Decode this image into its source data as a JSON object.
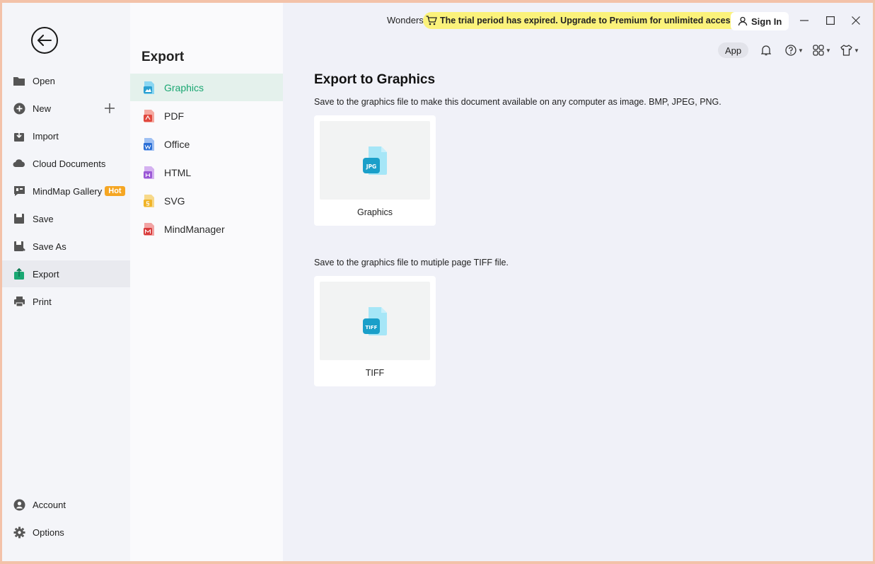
{
  "leftnav": {
    "items": [
      {
        "id": "open",
        "label": "Open"
      },
      {
        "id": "new",
        "label": "New"
      },
      {
        "id": "import",
        "label": "Import"
      },
      {
        "id": "cloud",
        "label": "Cloud Documents"
      },
      {
        "id": "gallery",
        "label": "MindMap Gallery"
      },
      {
        "id": "save",
        "label": "Save"
      },
      {
        "id": "saveas",
        "label": "Save As"
      },
      {
        "id": "export",
        "label": "Export"
      },
      {
        "id": "print",
        "label": "Print"
      }
    ],
    "hot_badge": "Hot",
    "bottom": [
      {
        "id": "account",
        "label": "Account"
      },
      {
        "id": "options",
        "label": "Options"
      }
    ]
  },
  "export": {
    "title": "Export",
    "formats": [
      {
        "label": "Graphics",
        "color": "#3ab8e6"
      },
      {
        "label": "PDF",
        "color": "#e0483e"
      },
      {
        "label": "Office",
        "color": "#2b6fd6"
      },
      {
        "label": "HTML",
        "color": "#9b59d6"
      },
      {
        "label": "SVG",
        "color": "#f0b429"
      },
      {
        "label": "MindManager",
        "color": "#d83b3b"
      }
    ]
  },
  "topbar": {
    "app_name": "Wonders",
    "trial_text": "The trial period has expired. Upgrade to Premium for unlimited access.",
    "signin": "Sign In",
    "app_button": "App"
  },
  "main": {
    "title": "Export to Graphics",
    "desc1": "Save to the graphics file to make this document available on any computer as image.  BMP, JPEG, PNG.",
    "card1": {
      "label": "Graphics",
      "badge": "JPG"
    },
    "desc2": "Save to the graphics file to mutiple page TIFF file.",
    "card2": {
      "label": "TIFF",
      "badge": "TIFF"
    }
  },
  "colors": {
    "accent": "#1aa772",
    "banner": "#fbf27b",
    "hot": "#f5a623"
  }
}
